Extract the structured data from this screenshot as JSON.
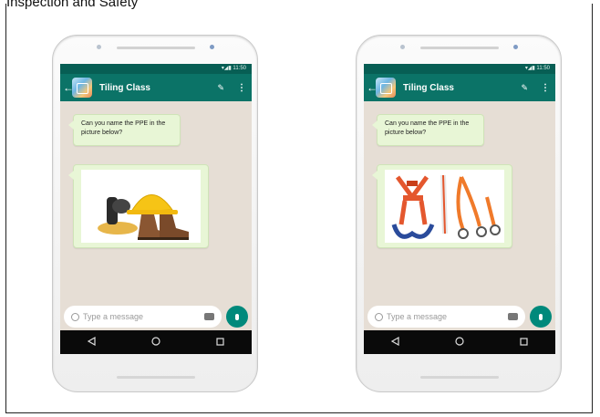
{
  "page": {
    "top_text": "Inspection and Safety"
  },
  "phones": [
    {
      "status_time": "11:50",
      "chat_title": "Tiling Class",
      "question": "Can you name the PPE in the picture below?",
      "image_icon": "hard-hat-boots-goggles-gloves-image",
      "input_placeholder": "Type a message"
    },
    {
      "status_time": "11:50",
      "chat_title": "Tiling Class",
      "question": "Can you name the PPE in the picture below?",
      "image_icon": "safety-harness-lanyard-image",
      "input_placeholder": "Type a message"
    }
  ],
  "colors": {
    "status_bar": "#075e54",
    "app_bar": "#0b7367",
    "chat_background": "#e6ded5",
    "bubble": "#e8f6d6",
    "mic_button": "#00897b",
    "nav_bar": "#0a0a0a"
  }
}
